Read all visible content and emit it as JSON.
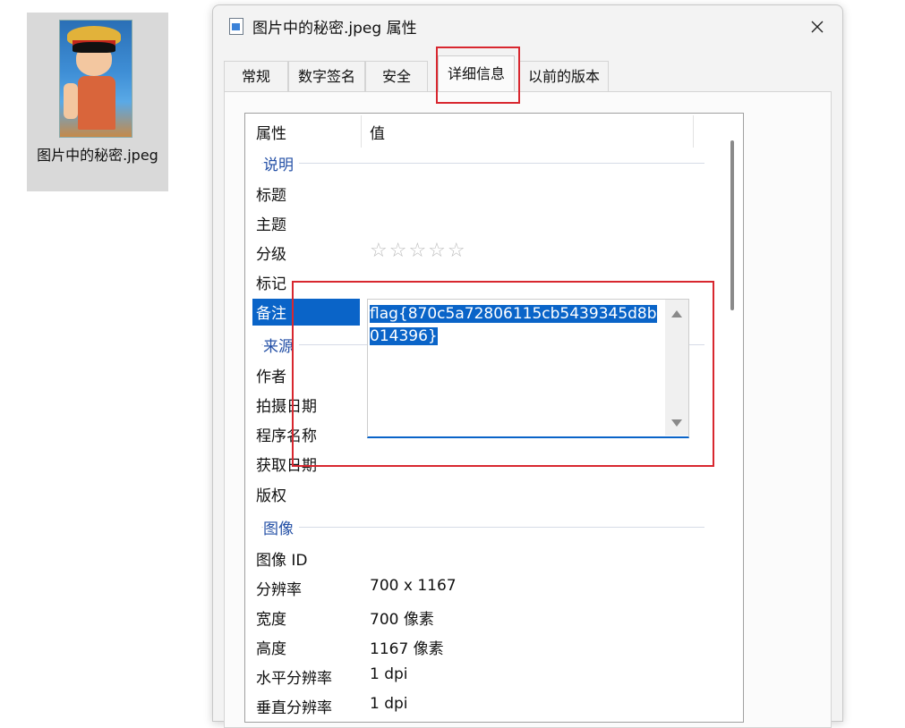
{
  "desktop": {
    "file_label": "图片中的秘密.jpeg"
  },
  "dialog": {
    "title": "图片中的秘密.jpeg 属性",
    "tabs": [
      {
        "label": "常规"
      },
      {
        "label": "数字签名"
      },
      {
        "label": "安全"
      },
      {
        "label": "详细信息",
        "active": true
      },
      {
        "label": "以前的版本"
      }
    ],
    "list": {
      "header_property": "属性",
      "header_value": "值",
      "groups": {
        "description": "说明",
        "origin": "来源",
        "image": "图像"
      },
      "rows": {
        "title": {
          "name": "标题",
          "value": ""
        },
        "subject": {
          "name": "主题",
          "value": ""
        },
        "rating": {
          "name": "分级",
          "value": "☆☆☆☆☆"
        },
        "tags": {
          "name": "标记",
          "value": ""
        },
        "comments": {
          "name": "备注",
          "value": "flag{870c5a72806115cb5439345d8b014396}"
        },
        "authors": {
          "name": "作者",
          "value": ""
        },
        "date_taken": {
          "name": "拍摄日期",
          "value": ""
        },
        "program_name": {
          "name": "程序名称",
          "value": ""
        },
        "date_acquired": {
          "name": "获取日期",
          "value": ""
        },
        "copyright": {
          "name": "版权",
          "value": ""
        },
        "image_id": {
          "name": "图像 ID",
          "value": ""
        },
        "dimensions": {
          "name": "分辨率",
          "value": "700 x 1167"
        },
        "width": {
          "name": "宽度",
          "value": "700 像素"
        },
        "height": {
          "name": "高度",
          "value": "1167 像素"
        },
        "h_resolution": {
          "name": "水平分辨率",
          "value": "1 dpi"
        },
        "v_resolution": {
          "name": "垂直分辨率",
          "value": "1 dpi"
        }
      }
    }
  },
  "colors": {
    "accent": "#0a64c8",
    "highlight_box": "#d8272f",
    "group_text": "#2450a6"
  }
}
